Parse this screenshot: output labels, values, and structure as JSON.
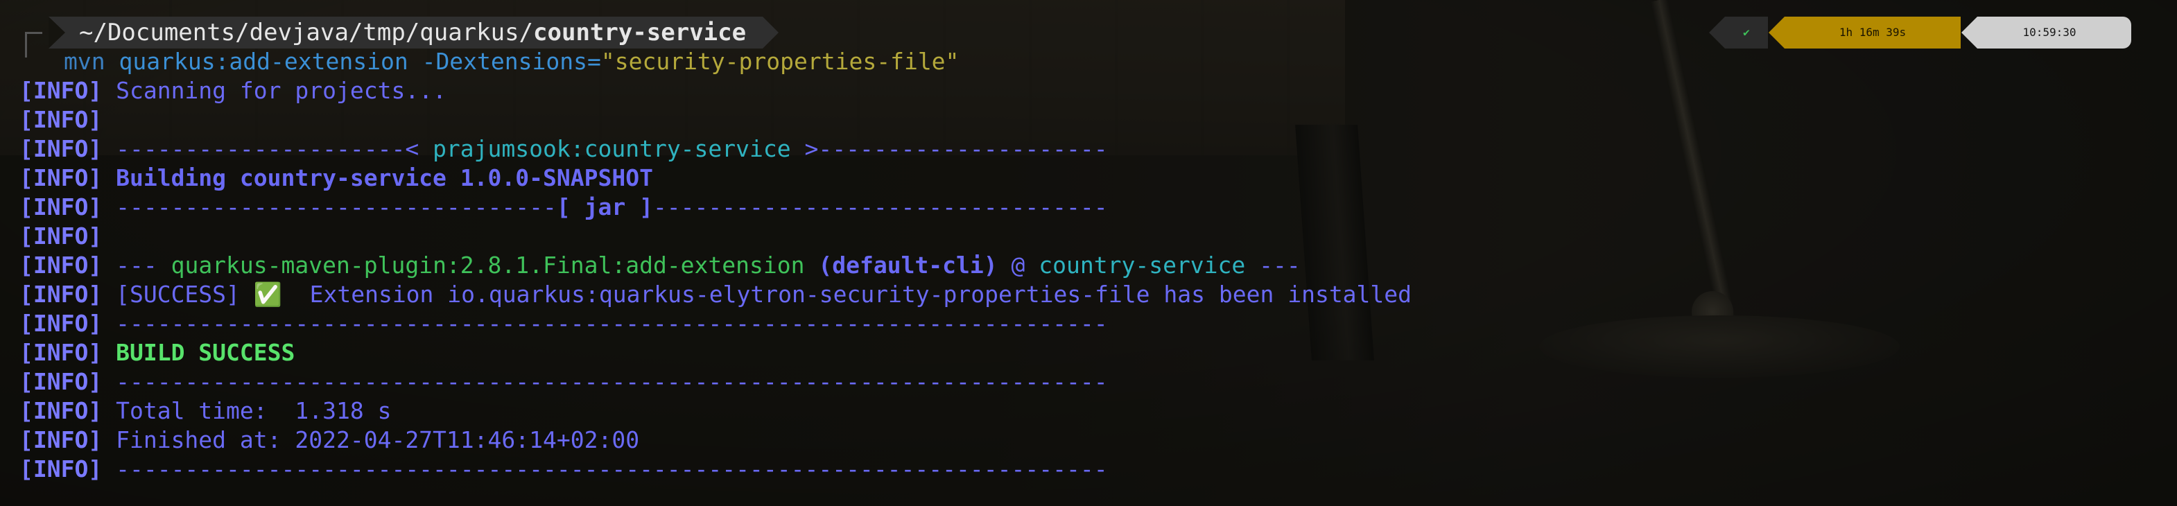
{
  "prompt": {
    "path_prefix": "~/Documents/devjava/tmp/quarkus/",
    "path_dir": "country-service",
    "command": "mvn",
    "args": "quarkus:add-extension -Dextensions=",
    "quoted": "\"security-properties-file\"",
    "status_ok_icon": "✔",
    "elapsed": "1h 16m 39s",
    "clock": "10:59:30"
  },
  "tag": "[INFO]",
  "output": {
    "scanning": "Scanning for projects...",
    "sep_left": "---------------------< ",
    "artifact": "prajumsook:country-service",
    "sep_right": " >---------------------",
    "building": "Building country-service 1.0.0-SNAPSHOT",
    "jar_left": "--------------------------------",
    "jar": "[ jar ]",
    "jar_right": "---------------------------------",
    "plugin_dashes": "--- ",
    "plugin": "quarkus-maven-plugin:2.8.1.Final:add-extension",
    "plugin_id": " (default-cli)",
    "plugin_at": " @ ",
    "plugin_project": "country-service",
    "plugin_end": " ---",
    "success_tag": "[SUCCESS]",
    "success_emoji": "✅",
    "success_msg": "  Extension io.quarkus:quarkus-elytron-security-properties-file has been installed",
    "rule": "------------------------------------------------------------------------",
    "build_success": "BUILD SUCCESS",
    "total_time": "Total time:  1.318 s",
    "finished_at": "Finished at: 2022-04-27T11:46:14+02:00"
  }
}
